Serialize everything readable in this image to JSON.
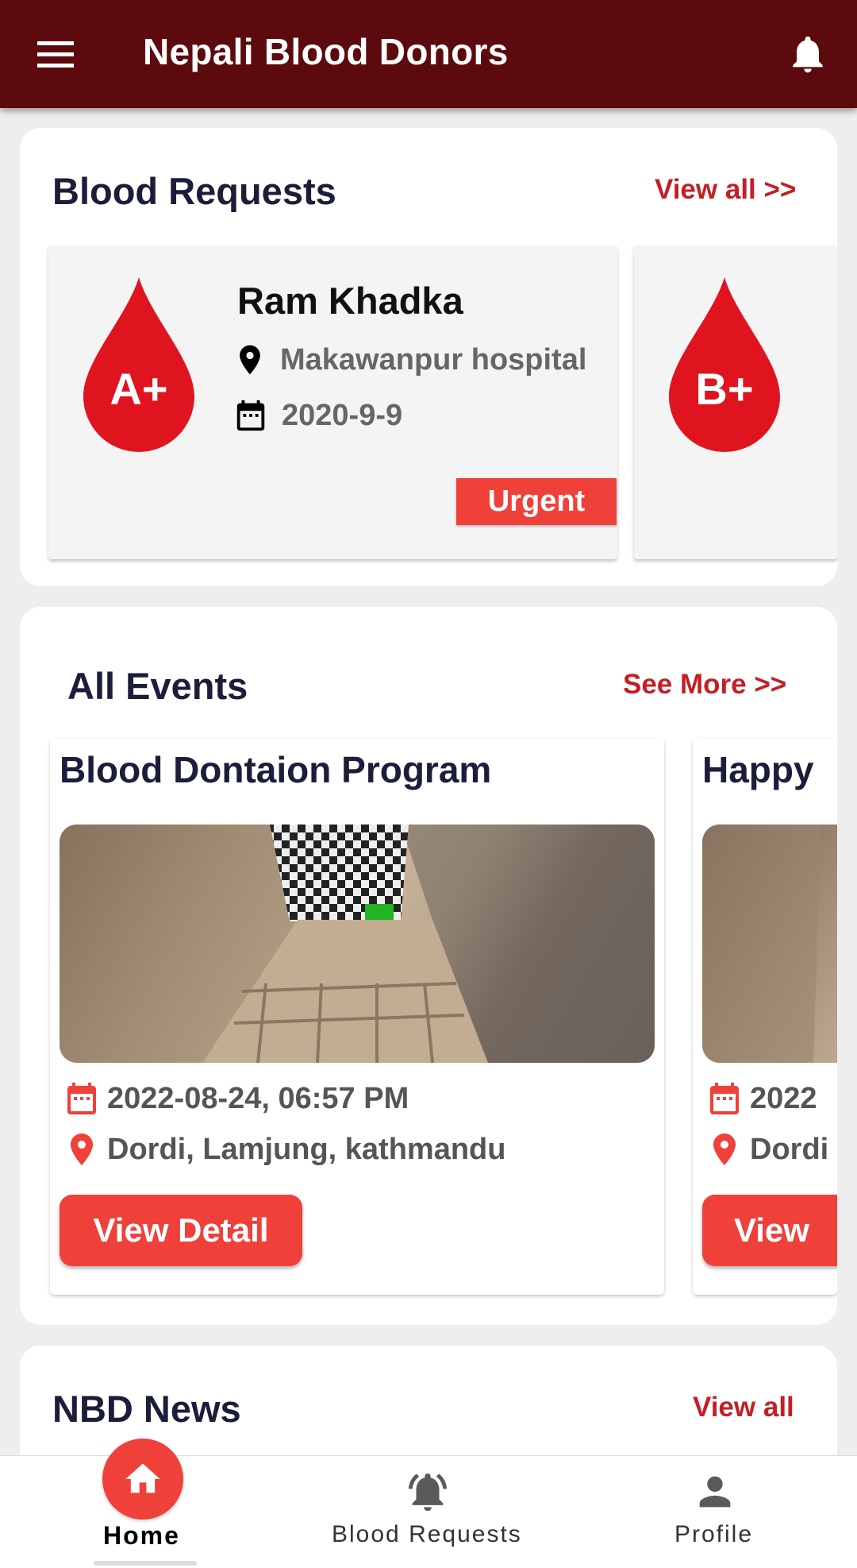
{
  "app": {
    "title": "Nepali Blood Donors"
  },
  "blood_requests": {
    "title": "Blood Requests",
    "view_all": "View all >>",
    "items": [
      {
        "blood_group": "A+",
        "name": "Ram Khadka",
        "location": "Makawanpur hospital",
        "date": "2020-9-9",
        "badge": "Urgent"
      },
      {
        "blood_group": "B+"
      }
    ]
  },
  "events": {
    "title": "All Events",
    "see_more": "See More >>",
    "items": [
      {
        "title": "Blood Dontaion Program",
        "datetime": "2022-08-24, 06:57 PM",
        "location": "Dordi, Lamjung, kathmandu",
        "button": "View Detail"
      },
      {
        "title": "Happy",
        "datetime": "2022",
        "location": "Dordi",
        "button": "View"
      }
    ]
  },
  "news": {
    "title": "NBD News",
    "view_all": "View all"
  },
  "bottom_nav": {
    "home": "Home",
    "blood_requests": "Blood Requests",
    "profile": "Profile"
  },
  "colors": {
    "appbar": "#5c0a0d",
    "accent": "#f0403a",
    "drop": "#e0141f",
    "link": "#c41e26"
  }
}
